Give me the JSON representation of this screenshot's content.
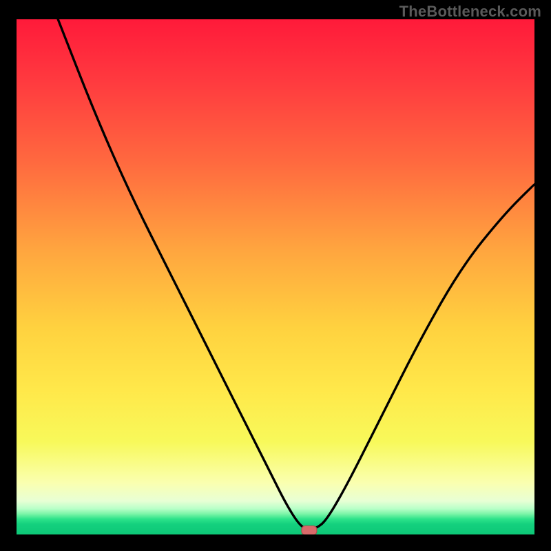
{
  "watermark": "TheBottleneck.com",
  "colors": {
    "bg_frame": "#000000",
    "watermark": "#5a5a5a",
    "curve": "#000000",
    "marker_fill": "#d86a6a",
    "marker_stroke": "#b04a4a",
    "gradient_stops": [
      "#ff1a3a",
      "#ff3a3f",
      "#ff6a3f",
      "#ffa63f",
      "#ffd23f",
      "#ffe84a",
      "#f8f95a",
      "#faffb0",
      "#e8ffd5",
      "#b8ffc8",
      "#7cf5a8",
      "#2de38a",
      "#14d07e",
      "#0dc877"
    ]
  },
  "chart_data": {
    "type": "line",
    "title": "",
    "xlabel": "",
    "ylabel": "",
    "xlim": [
      0,
      100
    ],
    "ylim": [
      0,
      100
    ],
    "grid": false,
    "note": "Axes are unlabeled; x and y are read as percentage of plot width/height. y=100 at top, y=0 at bottom baseline.",
    "series": [
      {
        "name": "bottleneck-curve",
        "x": [
          8,
          15,
          22,
          30,
          38,
          44,
          49,
          52,
          54.5,
          56,
          58,
          60,
          64,
          70,
          78,
          86,
          94,
          100
        ],
        "y": [
          100,
          82,
          66,
          50,
          34,
          22,
          12,
          6,
          2,
          1,
          1.2,
          3,
          10,
          22,
          38,
          52,
          62,
          68
        ]
      }
    ],
    "marker": {
      "x": 56.5,
      "y": 0.8,
      "shape": "rounded-rect"
    }
  }
}
